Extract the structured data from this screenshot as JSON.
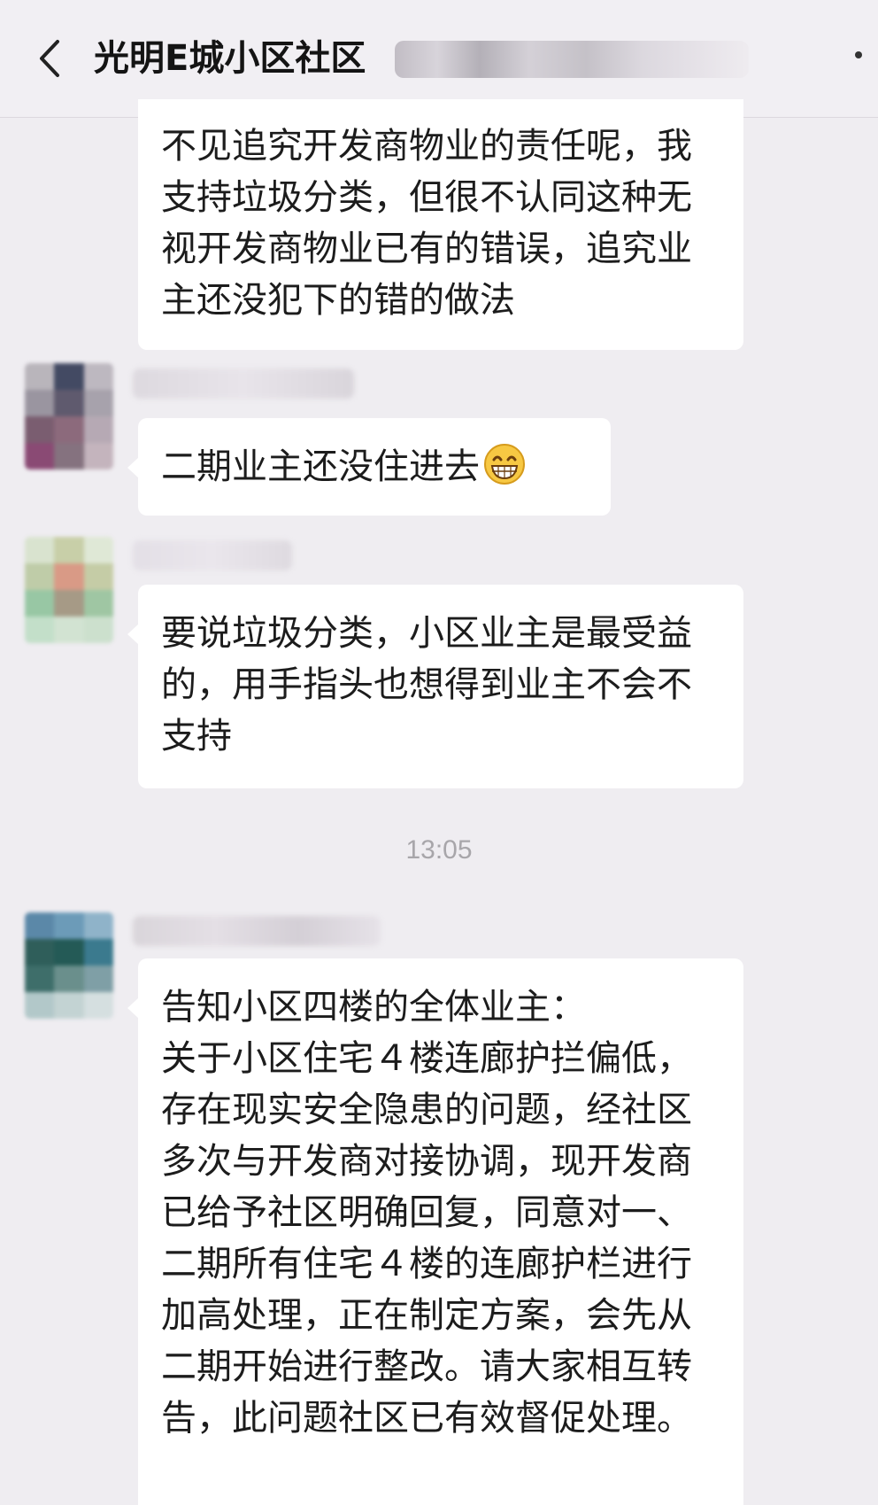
{
  "header": {
    "title": "光明E城小区社区",
    "back_icon": "chevron-left-icon",
    "more_icon": "more-dots-icon"
  },
  "messages": [
    {
      "lines": [
        "不见追究开发商物业的责任呢，我",
        "支持垃圾分类，但很不认同这种无",
        "视开发商物业已有的错误，追究业",
        "主还没犯下的错的做法"
      ]
    },
    {
      "text": "二期业主还没住进去",
      "emoji": "grinning-face-icon"
    },
    {
      "lines": [
        "要说垃圾分类，小区业主是最受益",
        "的，用手指头也想得到业主不会不",
        "支持"
      ]
    },
    {
      "lines": [
        "告知小区四楼的全体业主：",
        "关于小区住宅４楼连廊护拦偏低，",
        "存在现实安全隐患的问题，经社区",
        "多次与开发商对接协调，现开发商",
        "已给予社区明确回复，同意对一、",
        "二期所有住宅４楼的连廊护栏进行",
        "加高处理，正在制定方案，会先从",
        "二期开始进行整改。请大家相互转",
        "告，此问题社区已有效督促处理。"
      ]
    }
  ],
  "timestamp": "13:05",
  "colors": {
    "background": "#efedf1",
    "bubble": "#ffffff",
    "text": "#1c1c1c",
    "timestamp": "#a8a6aa"
  }
}
